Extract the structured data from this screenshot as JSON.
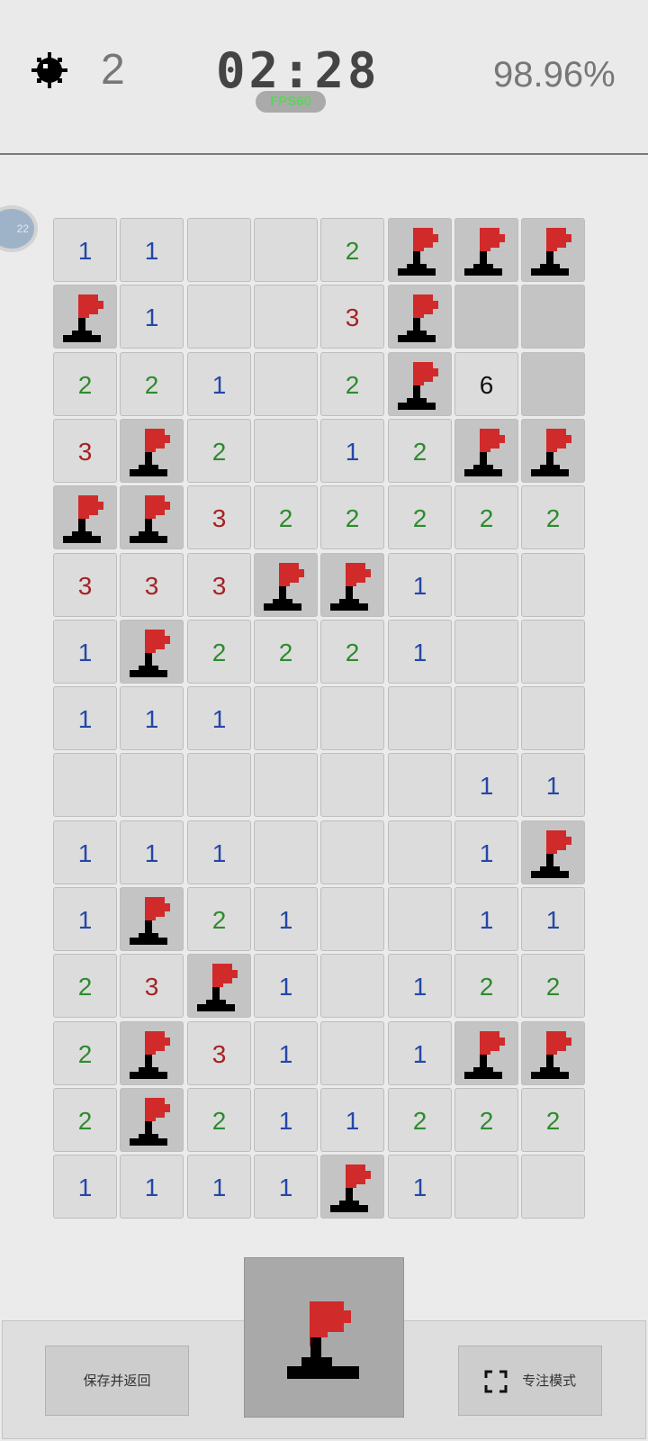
{
  "header": {
    "mine_icon": "mine-icon",
    "mines_remaining": "2",
    "timer": "02:28",
    "fps": "FPS60",
    "progress_percent": "98.96%"
  },
  "avatar": {
    "label": "22"
  },
  "board": {
    "rows": 15,
    "cols": 8,
    "flag_icon": "flag-icon",
    "cells": [
      [
        "1",
        "1",
        "",
        "",
        "2",
        "F",
        "F",
        "F"
      ],
      [
        "F",
        "1",
        "",
        "",
        "3",
        "F",
        "#",
        "#"
      ],
      [
        "2",
        "2",
        "1",
        "",
        "2",
        "F",
        "6",
        "#"
      ],
      [
        "3",
        "F",
        "2",
        "",
        "1",
        "2",
        "F",
        "F"
      ],
      [
        "F",
        "F",
        "3",
        "2",
        "2",
        "2",
        "2",
        "2"
      ],
      [
        "3",
        "3",
        "3",
        "F",
        "F",
        "1",
        "",
        ""
      ],
      [
        "1",
        "F",
        "2",
        "2",
        "2",
        "1",
        "",
        ""
      ],
      [
        "1",
        "1",
        "1",
        "",
        "",
        "",
        "",
        ""
      ],
      [
        "",
        "",
        "",
        "",
        "",
        "",
        "1",
        "1"
      ],
      [
        "1",
        "1",
        "1",
        "",
        "",
        "",
        "1",
        "F"
      ],
      [
        "1",
        "F",
        "2",
        "1",
        "",
        "",
        "1",
        "1"
      ],
      [
        "2",
        "3",
        "F",
        "1",
        "",
        "1",
        "2",
        "2"
      ],
      [
        "2",
        "F",
        "3",
        "1",
        "",
        "1",
        "F",
        "F"
      ],
      [
        "2",
        "F",
        "2",
        "1",
        "1",
        "2",
        "2",
        "2"
      ],
      [
        "1",
        "1",
        "1",
        "1",
        "F",
        "1",
        "",
        ""
      ]
    ]
  },
  "controls": {
    "save_label": "保存并返回",
    "mode_icon": "flag-icon",
    "focus_label": "专注模式",
    "focus_icon": "fullscreen-icon"
  },
  "colors": {
    "n1": "#2447a8",
    "n2": "#2e8b2e",
    "n3": "#a52323",
    "flag_red": "#d12a2a",
    "unrevealed": "#c4c4c4",
    "revealed": "#dcdcdc"
  }
}
